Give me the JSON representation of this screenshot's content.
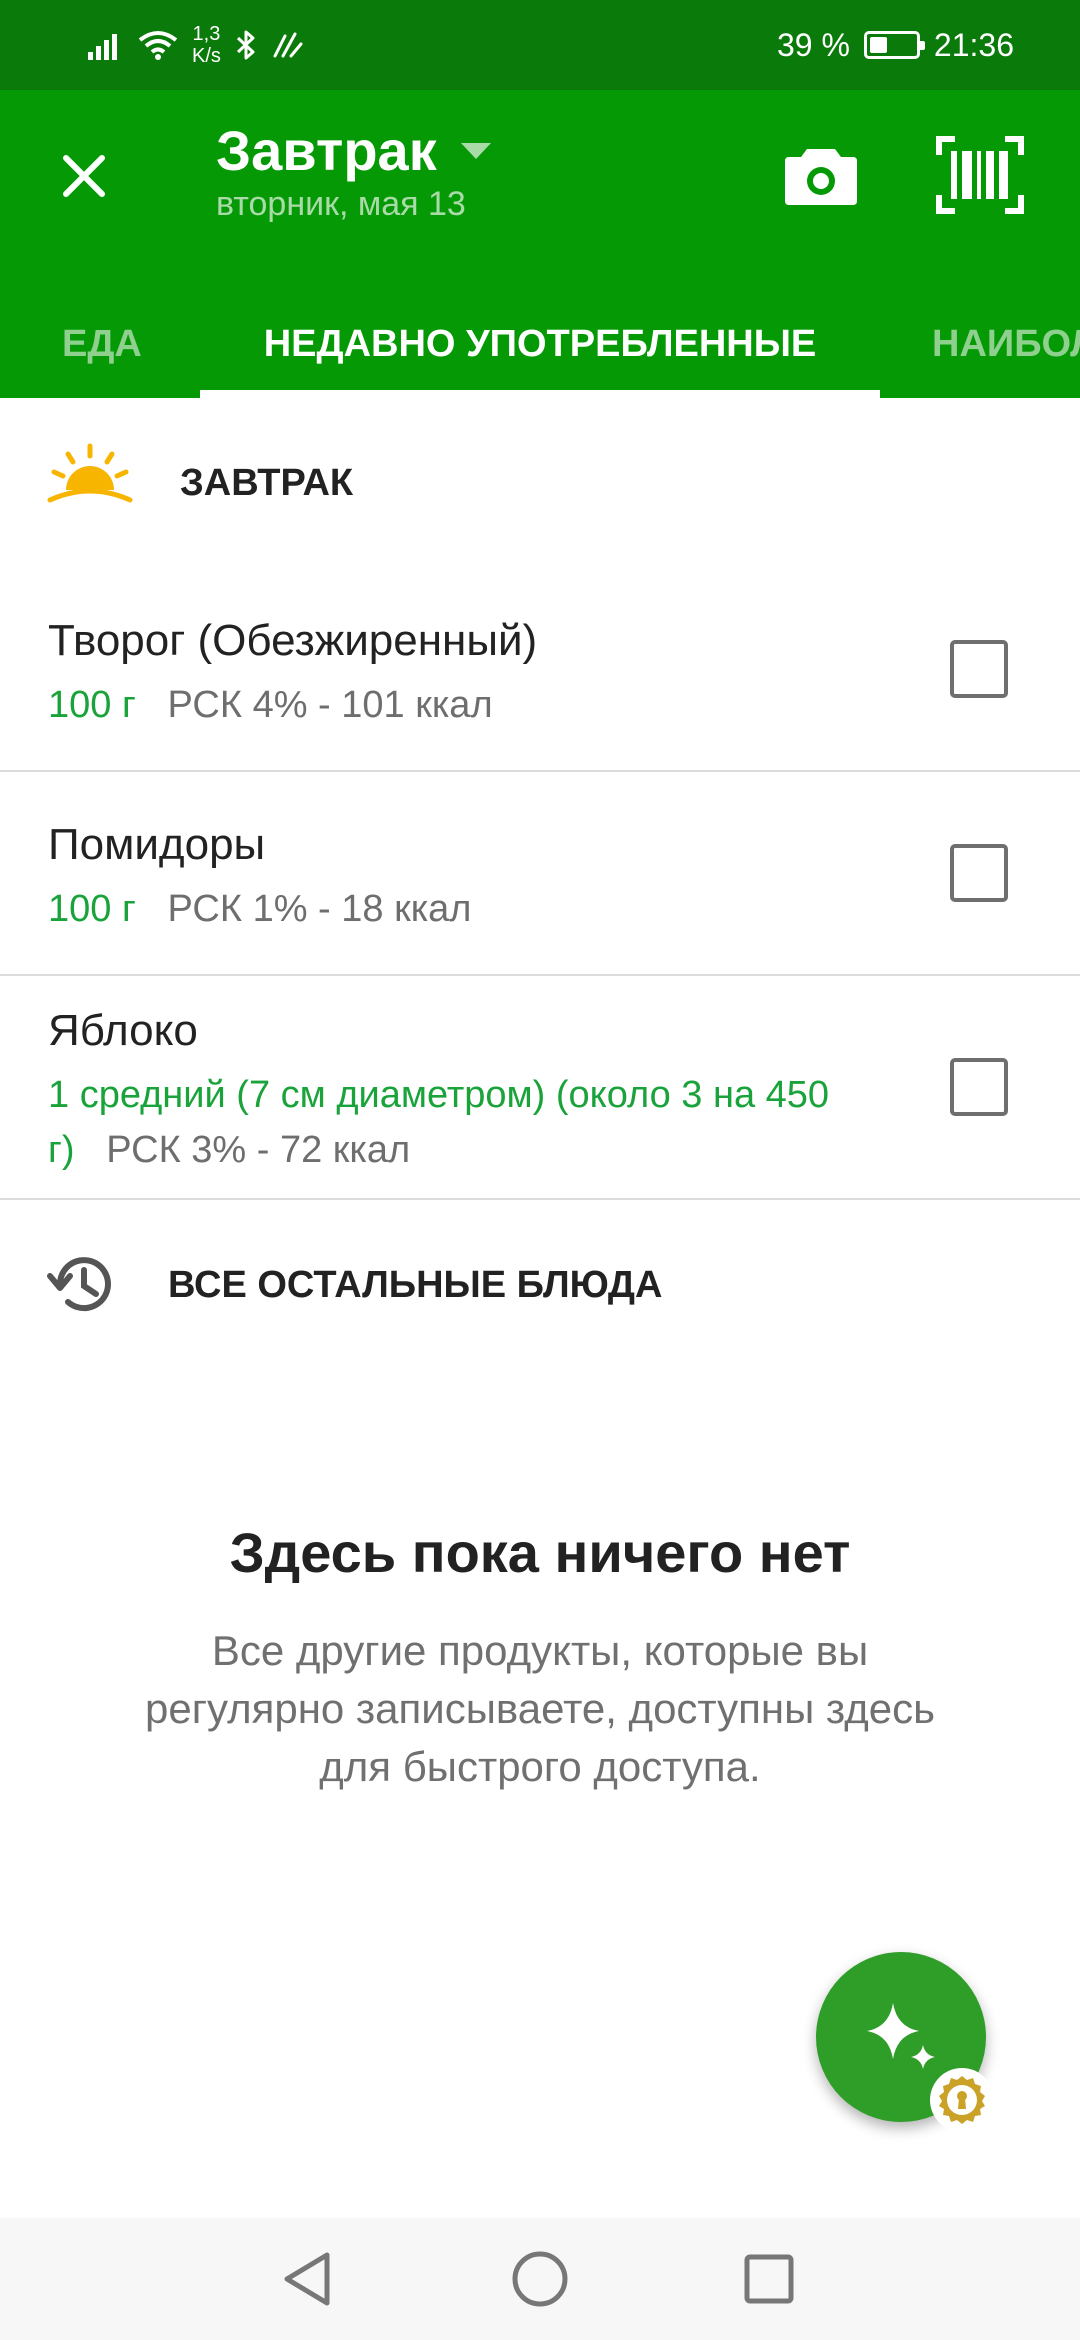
{
  "status_bar": {
    "net_speed_value": "1,3",
    "net_speed_unit": "K/s",
    "battery_percent": "39 %",
    "battery_level": 0.39,
    "time": "21:36"
  },
  "app_bar": {
    "title": "Завтрак",
    "subtitle": "вторник, мая 13"
  },
  "tabs": [
    {
      "label": "ЕДА",
      "active": false
    },
    {
      "label": "НЕДАВНО УПОТРЕБЛЕННЫЕ",
      "active": true
    },
    {
      "label": "НАИБОЛ",
      "active": false
    }
  ],
  "meal_section": {
    "label": "ЗАВТРАК"
  },
  "foods": [
    {
      "name": "Творог (Обезжиренный)",
      "portion": "100 г",
      "nutrition": "РСК 4% - 101 ккал",
      "checked": false
    },
    {
      "name": "Помидоры",
      "portion": "100 г",
      "nutrition": "РСК 1% - 18 ккал",
      "checked": false
    },
    {
      "name": "Яблоко",
      "portion": "1 средний (7 см диаметром) (около 3 на 450 г)",
      "nutrition": "РСК 3% - 72 ккал",
      "checked": false
    }
  ],
  "others_section": {
    "label": "ВСЕ ОСТАЛЬНЫЕ БЛЮДА"
  },
  "empty_state": {
    "title": "Здесь пока ничего нет",
    "text": "Все другие продукты, которые вы регулярно записываете, доступны здесь для быстрого доступа."
  },
  "colors": {
    "status_bar": "#0a7a0a",
    "app_bar": "#059a05",
    "accent_green": "#1aa33a",
    "fab": "#2e9e28",
    "premium_gold": "#c9a227"
  },
  "icons": {
    "close": "close-icon",
    "dropdown": "dropdown-arrow-icon",
    "camera": "camera-icon",
    "barcode": "barcode-scanner-icon",
    "sun": "sunrise-icon",
    "history": "history-icon",
    "fab": "sparkle-icon",
    "premium": "keyhole-badge-icon"
  }
}
